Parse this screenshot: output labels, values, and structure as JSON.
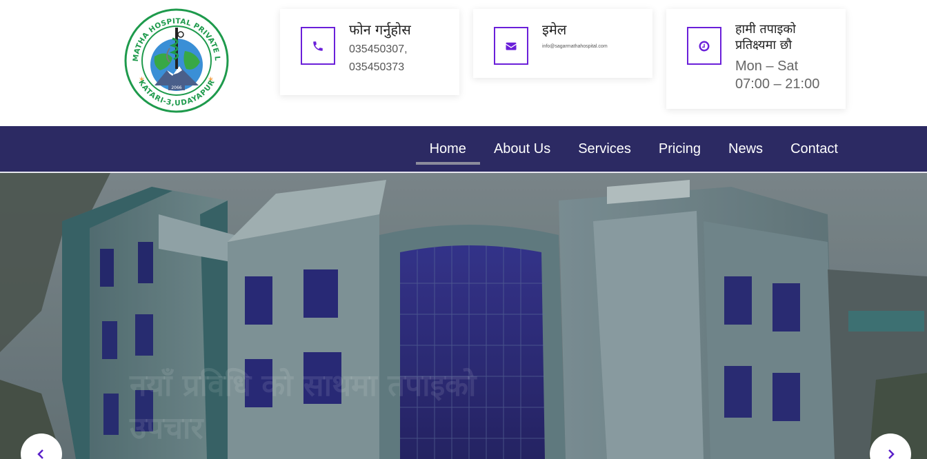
{
  "logo": {
    "top_text": "SAGARMATHA HOSPITAL PRIVATE LIMITED",
    "bottom_text": "KATARI-3,UDAYAPUR",
    "year": "2066"
  },
  "contact_cards": {
    "phone": {
      "icon": "phone-icon",
      "title": "फोन गर्नुहोस",
      "detail_line1": "035450307,",
      "detail_line2": "035450373"
    },
    "email": {
      "icon": "envelope-icon",
      "title": "इमेल",
      "detail": "info@sagarmathahospital.com"
    },
    "hours": {
      "icon": "clock-icon",
      "title_line1": "हामी तपाइको",
      "title_line2": "प्रतिक्ष्यमा छौ",
      "detail_line1": "Mon – Sat",
      "detail_line2": "07:00 – 21:00"
    }
  },
  "nav": {
    "items": [
      {
        "label": "Home",
        "active": true
      },
      {
        "label": "About Us",
        "active": false
      },
      {
        "label": "Services",
        "active": false
      },
      {
        "label": "Pricing",
        "active": false
      },
      {
        "label": "News",
        "active": false
      },
      {
        "label": "Contact",
        "active": false
      }
    ]
  },
  "hero": {
    "caption_line1": "नयाँ प्रविधि को साथमा तपाइको",
    "caption_line2": "उपचार"
  },
  "colors": {
    "accent": "#6a1fd9",
    "nav_bg": "#2c2a63",
    "logo_green": "#1e9a4c"
  }
}
